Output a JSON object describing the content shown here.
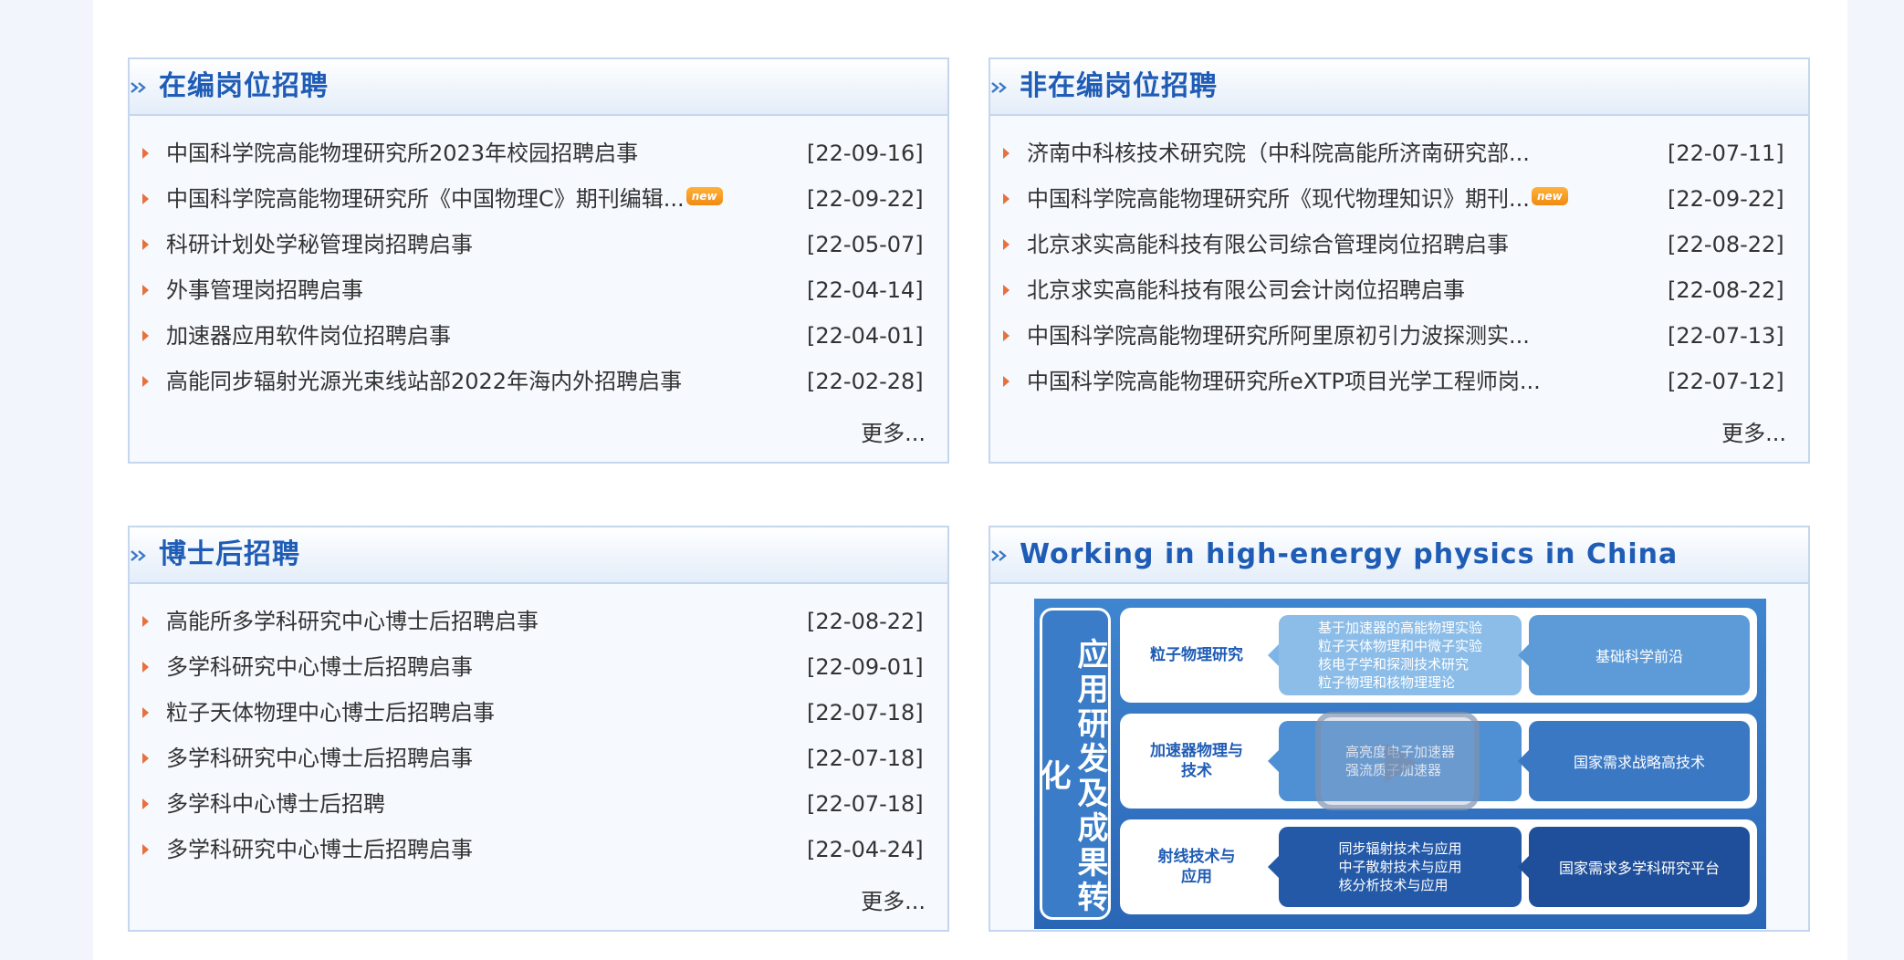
{
  "panels": {
    "staff": {
      "title": "在编岗位招聘",
      "more": "更多...",
      "items": [
        {
          "title": "中国科学院高能物理研究所2023年校园招聘启事",
          "date": "[22-09-16]",
          "is_new": false
        },
        {
          "title": "中国科学院高能物理研究所《中国物理C》期刊编辑...",
          "date": "[22-09-22]",
          "is_new": true
        },
        {
          "title": "科研计划处学秘管理岗招聘启事",
          "date": "[22-05-07]",
          "is_new": false
        },
        {
          "title": "外事管理岗招聘启事",
          "date": "[22-04-14]",
          "is_new": false
        },
        {
          "title": "加速器应用软件岗位招聘启事",
          "date": "[22-04-01]",
          "is_new": false
        },
        {
          "title": "高能同步辐射光源光束线站部2022年海内外招聘启事",
          "date": "[22-02-28]",
          "is_new": false
        }
      ]
    },
    "nonstaff": {
      "title": "非在编岗位招聘",
      "more": "更多...",
      "items": [
        {
          "title": "济南中科核技术研究院（中科院高能所济南研究部...",
          "date": "[22-07-11]",
          "is_new": false
        },
        {
          "title": "中国科学院高能物理研究所《现代物理知识》期刊...",
          "date": "[22-09-22]",
          "is_new": true
        },
        {
          "title": "北京求实高能科技有限公司综合管理岗位招聘启事",
          "date": "[22-08-22]",
          "is_new": false
        },
        {
          "title": "北京求实高能科技有限公司会计岗位招聘启事",
          "date": "[22-08-22]",
          "is_new": false
        },
        {
          "title": "中国科学院高能物理研究所阿里原初引力波探测实...",
          "date": "[22-07-13]",
          "is_new": false
        },
        {
          "title": "中国科学院高能物理研究所eXTP项目光学工程师岗...",
          "date": "[22-07-12]",
          "is_new": false
        }
      ]
    },
    "postdoc": {
      "title": "博士后招聘",
      "more": "更多...",
      "items": [
        {
          "title": "高能所多学科研究中心博士后招聘启事",
          "date": "[22-08-22]",
          "is_new": false
        },
        {
          "title": "多学科研究中心博士后招聘启事",
          "date": "[22-09-01]",
          "is_new": false
        },
        {
          "title": "粒子天体物理中心博士后招聘启事",
          "date": "[22-07-18]",
          "is_new": false
        },
        {
          "title": "多学科研究中心博士后招聘启事",
          "date": "[22-07-18]",
          "is_new": false
        },
        {
          "title": "多学科中心博士后招聘",
          "date": "[22-07-18]",
          "is_new": false
        },
        {
          "title": "多学科研究中心博士后招聘启事",
          "date": "[22-04-24]",
          "is_new": false
        }
      ]
    },
    "video": {
      "title": "Working in high-energy physics in China",
      "diagram": {
        "vertical_title": "应用研发及成果转化",
        "rows": [
          {
            "label": "粒子物理研究",
            "middle": [
              "基于加速器的高能物理实验",
              "粒子天体物理和中微子实验",
              "核电子学和探测技术研究",
              "粒子物理和核物理理论"
            ],
            "right": "基础科学前沿"
          },
          {
            "label": "加速器物理与技术",
            "middle": [
              "高亮度电子加速器",
              "强流质子加速器"
            ],
            "right": "国家需求战略高技术"
          },
          {
            "label": "射线技术与应用",
            "middle": [
              "同步辐射技术与应用",
              "中子散射技术与应用",
              "核分析技术与应用"
            ],
            "right": "国家需求多学科研究平台"
          }
        ]
      }
    }
  },
  "new_badge_text": "new",
  "colors": {
    "title": "#1f5cb5",
    "bullet": "#e8703a",
    "border": "#c5d6ee"
  }
}
